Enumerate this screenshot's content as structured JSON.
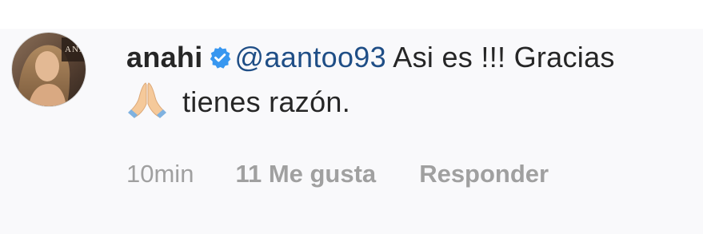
{
  "comment": {
    "username": "anahi",
    "verified_icon": "verified-badge-icon",
    "mention": "@aantoo93",
    "text_line1": " Asi es !!! Gracias",
    "emoji": "folded-hands-emoji",
    "text_line2": "tienes razón.",
    "avatar_logo_text": "ANA"
  },
  "actions": {
    "time": "10min",
    "likes": "11 Me gusta",
    "reply": "Responder"
  },
  "colors": {
    "mention": "#1f4e86",
    "verified": "#3897f0",
    "meta_text": "#a0a0a0",
    "row_background": "#f9f9fb"
  }
}
